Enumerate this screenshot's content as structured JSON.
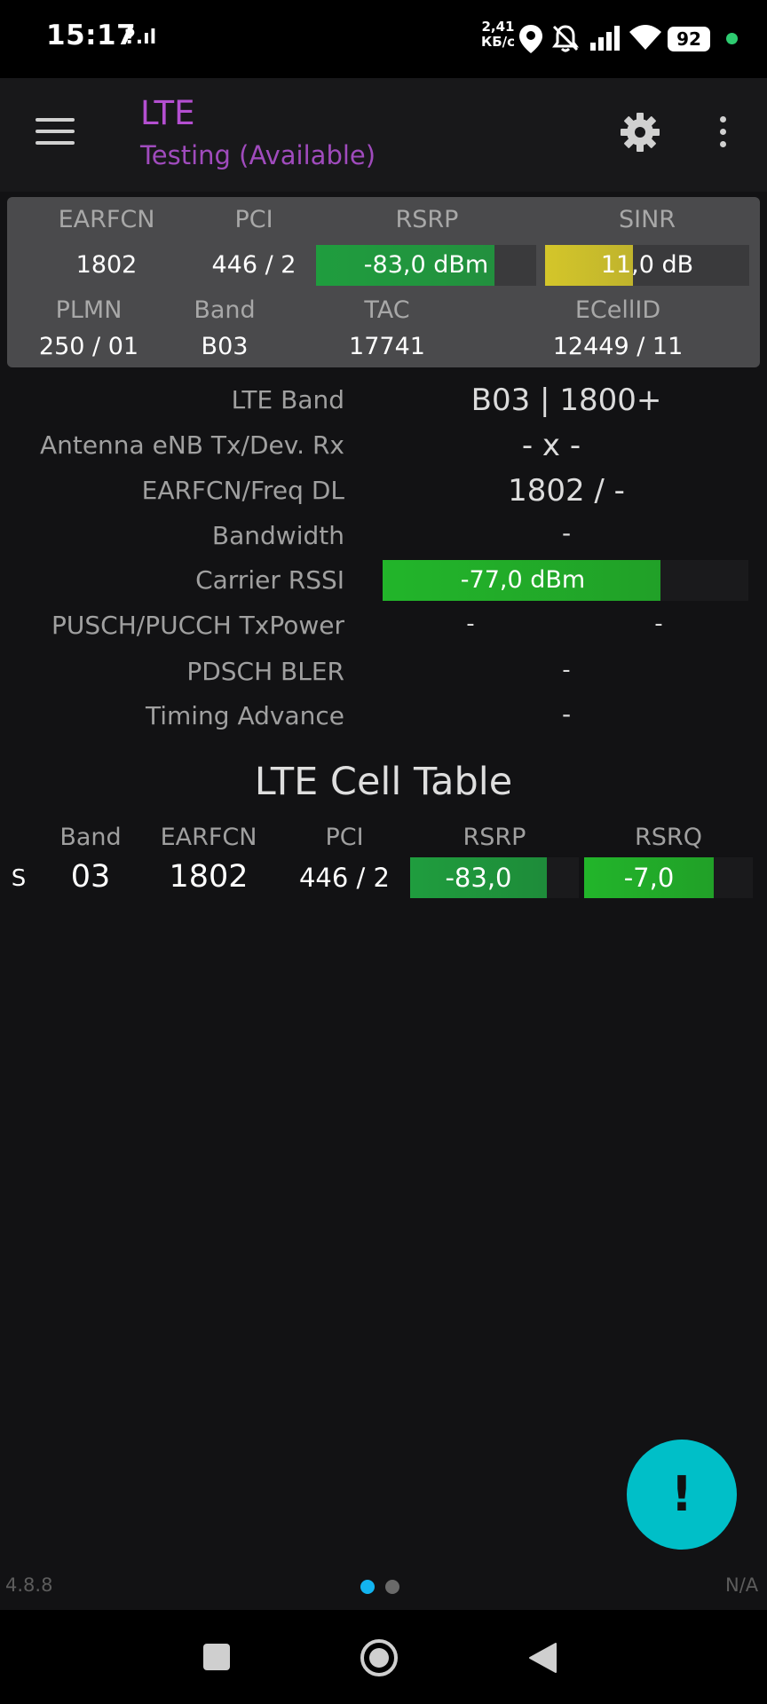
{
  "status_bar": {
    "time": "15:17",
    "signal_small": "?.ıl",
    "speed_top": "2,41",
    "speed_bottom": "КБ/с",
    "battery": "92"
  },
  "app_bar": {
    "title": "LTE",
    "subtitle": "Testing (Available)"
  },
  "summary": {
    "headers1": [
      "EARFCN",
      "PCI",
      "RSRP",
      "SINR"
    ],
    "earfcn": "1802",
    "pci": "446 / 2",
    "rsrp": {
      "text": "-83,0 dBm",
      "level": 0.81,
      "color": "#1f9d3e"
    },
    "sinr": {
      "text": "11,0 dB",
      "level": 0.43,
      "color": "#d4c62a"
    },
    "headers2": [
      "PLMN",
      "Band",
      "TAC",
      "ECellID"
    ],
    "plmn": "250 / 01",
    "band": "B03",
    "tac": "17741",
    "ecellid": "12449 / 11"
  },
  "info": {
    "lte_band_label": "LTE Band",
    "lte_band_value": "B03 | 1800+",
    "antenna_label": "Antenna eNB Tx/Dev. Rx",
    "antenna_value": "- x -",
    "earfcn_freq_label": "EARFCN/Freq DL",
    "earfcn_freq_value": "1802 / -",
    "bandwidth_label": "Bandwidth",
    "bandwidth_value": "-",
    "carrier_rssi_label": "Carrier RSSI",
    "carrier_rssi": {
      "text": "-77,0 dBm",
      "level": 0.76,
      "color": "#22b52a"
    },
    "pusch_label": "PUSCH/PUCCH TxPower",
    "pusch_value": "-",
    "pucch_value": "-",
    "bler_label": "PDSCH BLER",
    "bler_value": "-",
    "ta_label": "Timing Advance",
    "ta_value": "-"
  },
  "cell_table": {
    "title": "LTE Cell Table",
    "headers": [
      "Band",
      "EARFCN",
      "PCI",
      "RSRP",
      "RSRQ"
    ],
    "row": {
      "type": "S",
      "band": "03",
      "earfcn": "1802",
      "pci": "446 / 2",
      "rsrp": {
        "text": "-83,0",
        "level": 0.81,
        "color": "#1f9d3e"
      },
      "rsrq": {
        "text": "-7,0",
        "level": 0.77,
        "color": "#22b52a"
      }
    }
  },
  "fab": {
    "label": "!"
  },
  "footer": {
    "version": "4.8.8",
    "na": "N/A"
  },
  "colors": {
    "accent": "#b44fd1",
    "fab": "#00bfc8",
    "page_dot_active": "#12b4f0"
  }
}
